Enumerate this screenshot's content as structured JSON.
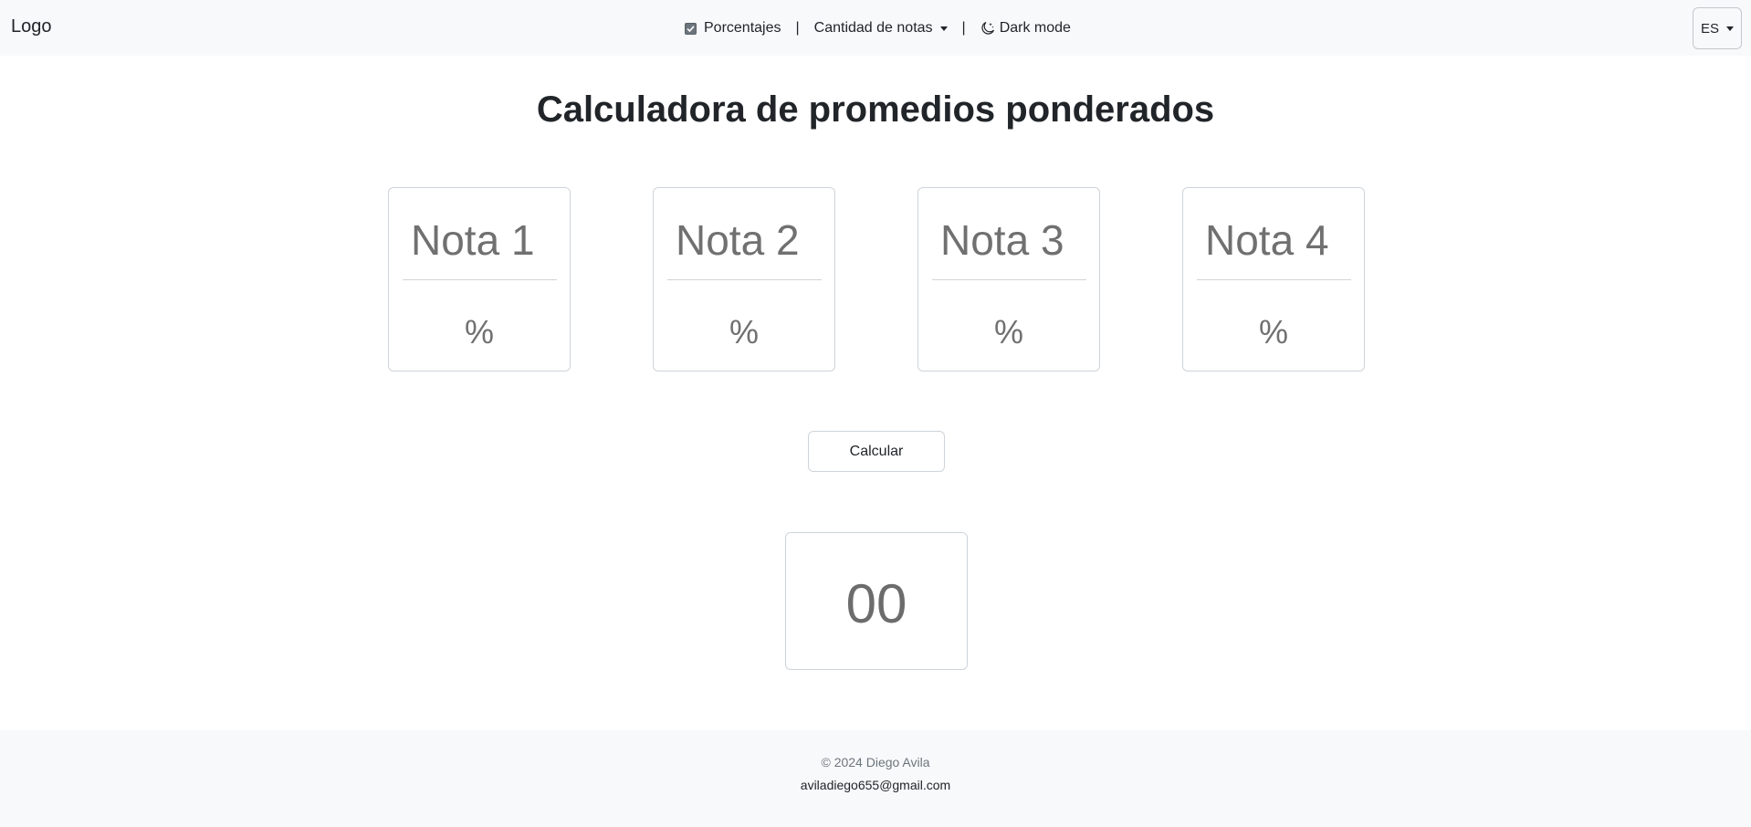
{
  "navbar": {
    "logo": "Logo",
    "percentages_label": "Porcentajes",
    "percentages_checked": true,
    "separator": "|",
    "grade_count_label": "Cantidad de notas",
    "dark_mode_label": "Dark mode",
    "language": "ES"
  },
  "main": {
    "title": "Calculadora de promedios ponderados",
    "cards": [
      {
        "grade_placeholder": "Nota 1",
        "percent_placeholder": "%"
      },
      {
        "grade_placeholder": "Nota 2",
        "percent_placeholder": "%"
      },
      {
        "grade_placeholder": "Nota 3",
        "percent_placeholder": "%"
      },
      {
        "grade_placeholder": "Nota 4",
        "percent_placeholder": "%"
      }
    ],
    "calculate_label": "Calcular",
    "result": "00"
  },
  "footer": {
    "copyright": "© 2024 Diego Avila",
    "email": "aviladiego655@gmail.com"
  },
  "icons": {
    "checkbox": "checkbox-checked-icon",
    "moon": "moon-stars-icon",
    "caret": "caret-down-icon"
  }
}
